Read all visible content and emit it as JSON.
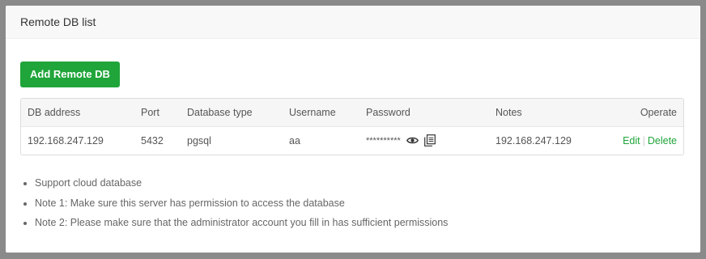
{
  "dialog": {
    "title": "Remote DB list"
  },
  "toolbar": {
    "add_label": "Add Remote DB"
  },
  "table": {
    "headers": {
      "db_address": "DB address",
      "port": "Port",
      "db_type": "Database type",
      "username": "Username",
      "password": "Password",
      "notes": "Notes",
      "operate": "Operate"
    },
    "rows": [
      {
        "db_address": "192.168.247.129",
        "port": "5432",
        "db_type": "pgsql",
        "username": "aa",
        "password_mask": "**********",
        "notes": "192.168.247.129",
        "edit_label": "Edit",
        "delete_label": "Delete",
        "separator": "|"
      }
    ]
  },
  "notes": {
    "items": [
      "Support cloud database",
      "Note 1: Make sure this server has permission to access the database",
      "Note 2: Please make sure that the administrator account you fill in has sufficient permissions"
    ]
  },
  "icons": {
    "show_password": "eye-icon",
    "copy_password": "copy-icon"
  },
  "colors": {
    "accent": "#20a53a",
    "header_bg": "#f8f8f8",
    "backdrop": "#8a8a8a"
  }
}
